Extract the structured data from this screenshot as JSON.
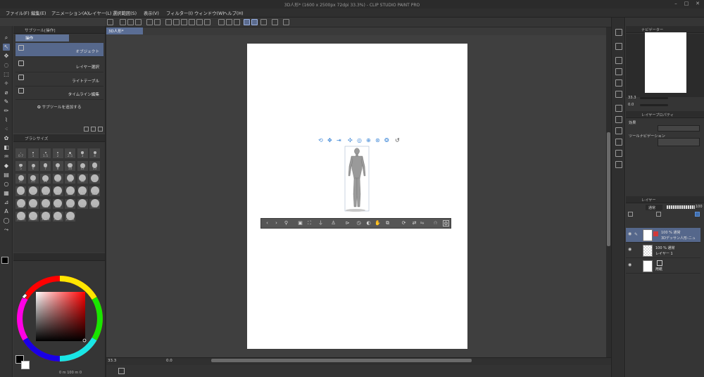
{
  "window": {
    "title": "3D人形* (1600 x 2500px 72dpi 33.3%)  - CLIP STUDIO PAINT PRO",
    "min_icon": "minimize-icon",
    "max_icon": "maximize-icon",
    "close_icon": "close-icon"
  },
  "menu": [
    {
      "label": "ファイル(F)"
    },
    {
      "label": "編集(E)"
    },
    {
      "label": "アニメーション(A)"
    },
    {
      "label": "レイヤー(L)"
    },
    {
      "label": "選択範囲(S)"
    },
    {
      "label": "表示(V)"
    },
    {
      "label": "フィルター(I)"
    },
    {
      "label": "ウィンドウ(W)"
    },
    {
      "label": "ヘルプ(H)"
    }
  ],
  "document_tab": {
    "label": "3D人形*"
  },
  "subtool_panel": {
    "title": "サブツール[操作]",
    "group_tab": "操作",
    "items": [
      {
        "label": "オブジェクト",
        "selected": true
      },
      {
        "label": "レイヤー選択",
        "selected": false
      },
      {
        "label": "ライトテーブル",
        "selected": false
      },
      {
        "label": "タイムライン編集",
        "selected": false
      }
    ],
    "add_label": "サブツールを追加する"
  },
  "brush_size_panel": {
    "title": "ブラシサイズ",
    "sizes": [
      "0.7",
      "1",
      "1.5",
      "2",
      "2.5",
      "3",
      "4",
      "5",
      "6",
      "7",
      "8",
      "10",
      "12",
      "15",
      "17",
      "20",
      "25",
      "30",
      "40",
      "50",
      "60",
      "70",
      "80",
      "100",
      "120",
      "150",
      "170",
      "200",
      "250",
      "300",
      "400",
      "500",
      "600",
      "700",
      "800",
      "1000",
      "1200",
      "1500",
      "1700",
      "2000"
    ]
  },
  "color_panel": {
    "main_color": "#000000",
    "sub_color": "#ffffff",
    "hue_accent": "#ff0000",
    "status_text": "0  m 100 m   0"
  },
  "status": {
    "zoom": "33.3",
    "angle": "0.0"
  },
  "navigator": {
    "title": "ナビゲーター",
    "zoom": "33.3",
    "angle": "0.0"
  },
  "layer_property": {
    "title": "レイヤープロパティ",
    "effect_label": "効果",
    "tool_nav_label": "ツールナビゲーション"
  },
  "layer_panel": {
    "title": "レイヤー",
    "blend_mode": "通常",
    "opacity": "100",
    "layers": [
      {
        "line1": "100 % 通常",
        "line2": "3Dデッサン人形-ニュ",
        "selected": true
      },
      {
        "line1": "100 % 通常",
        "line2": "レイヤー 1",
        "selected": false
      },
      {
        "line1": "",
        "line2": "用紙",
        "selected": false
      }
    ]
  },
  "colors": {
    "accent": "#5a6d94",
    "selection": "#55678b",
    "icon_blue": "#3f88d8",
    "paper": "#ffffff"
  }
}
